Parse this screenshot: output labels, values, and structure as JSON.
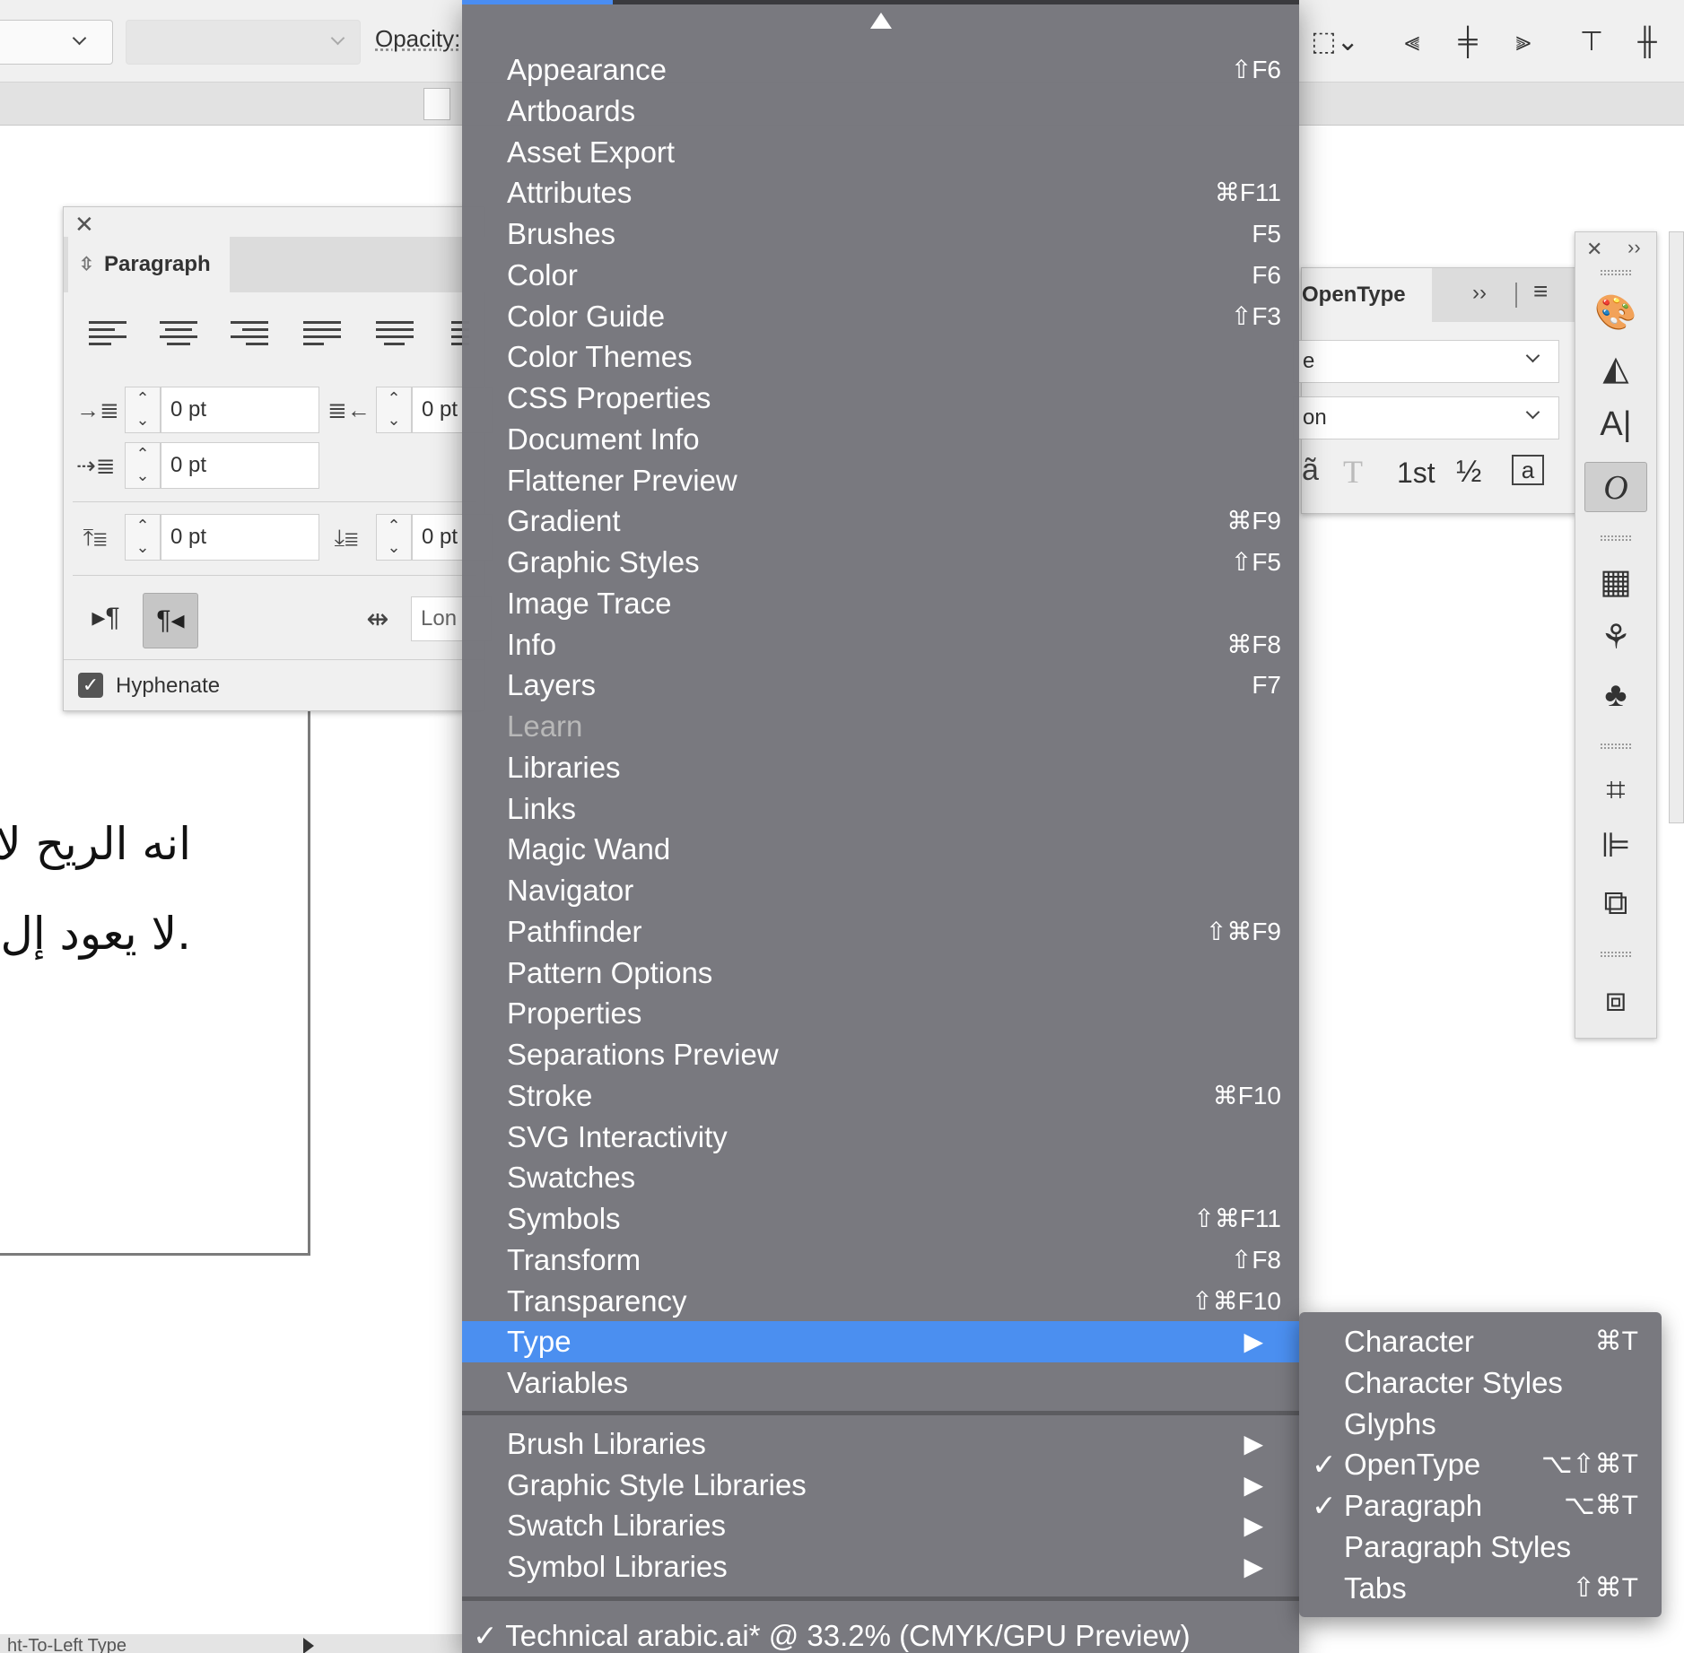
{
  "control_bar": {
    "opacity_label": "Opacity:"
  },
  "paragraph_panel": {
    "title": "Paragraph",
    "left_indent": "0 pt",
    "right_indent": "0 pt",
    "first_line_indent": "0 pt",
    "space_before": "0 pt",
    "space_after": "0 pt",
    "composer_value": "Lon",
    "hyphenate_label": "Hyphenate",
    "hyphenate_checked": true
  },
  "opentype_panel": {
    "title": "OpenType",
    "dropdown1_value": "e",
    "dropdown2_value": "on",
    "ordinal_glyph": "1st",
    "fraction_glyph": "½"
  },
  "document": {
    "line1": "انه الريح لا",
    "line2": ".لا يعود إل"
  },
  "status_bar": {
    "text": "ht-To-Left Type"
  },
  "window_menu": {
    "items": [
      {
        "label": "Appearance",
        "shortcut": "⇧F6"
      },
      {
        "label": "Artboards",
        "shortcut": ""
      },
      {
        "label": "Asset Export",
        "shortcut": ""
      },
      {
        "label": "Attributes",
        "shortcut": "⌘F11"
      },
      {
        "label": "Brushes",
        "shortcut": "F5"
      },
      {
        "label": "Color",
        "shortcut": "F6"
      },
      {
        "label": "Color Guide",
        "shortcut": "⇧F3"
      },
      {
        "label": "Color Themes",
        "shortcut": ""
      },
      {
        "label": "CSS Properties",
        "shortcut": ""
      },
      {
        "label": "Document Info",
        "shortcut": ""
      },
      {
        "label": "Flattener Preview",
        "shortcut": ""
      },
      {
        "label": "Gradient",
        "shortcut": "⌘F9"
      },
      {
        "label": "Graphic Styles",
        "shortcut": "⇧F5"
      },
      {
        "label": "Image Trace",
        "shortcut": ""
      },
      {
        "label": "Info",
        "shortcut": "⌘F8"
      },
      {
        "label": "Layers",
        "shortcut": "F7"
      },
      {
        "label": "Learn",
        "shortcut": "",
        "disabled": true
      },
      {
        "label": "Libraries",
        "shortcut": ""
      },
      {
        "label": "Links",
        "shortcut": ""
      },
      {
        "label": "Magic Wand",
        "shortcut": ""
      },
      {
        "label": "Navigator",
        "shortcut": ""
      },
      {
        "label": "Pathfinder",
        "shortcut": "⇧⌘F9"
      },
      {
        "label": "Pattern Options",
        "shortcut": ""
      },
      {
        "label": "Properties",
        "shortcut": ""
      },
      {
        "label": "Separations Preview",
        "shortcut": ""
      },
      {
        "label": "Stroke",
        "shortcut": "⌘F10"
      },
      {
        "label": "SVG Interactivity",
        "shortcut": ""
      },
      {
        "label": "Swatches",
        "shortcut": ""
      },
      {
        "label": "Symbols",
        "shortcut": "⇧⌘F11"
      },
      {
        "label": "Transform",
        "shortcut": "⇧F8"
      },
      {
        "label": "Transparency",
        "shortcut": "⇧⌘F10"
      },
      {
        "label": "Type",
        "shortcut": "",
        "submenu": true,
        "highlighted": true
      },
      {
        "label": "Variables",
        "shortcut": ""
      }
    ],
    "libraries": [
      {
        "label": "Brush Libraries"
      },
      {
        "label": "Graphic Style Libraries"
      },
      {
        "label": "Swatch Libraries"
      },
      {
        "label": "Symbol Libraries"
      }
    ],
    "open_document": "Technical arabic.ai* @ 33.2% (CMYK/GPU Preview)",
    "open_document_checked": true,
    "highlight_color": "#4b8ff0"
  },
  "type_submenu": {
    "items": [
      {
        "label": "Character",
        "shortcut": "⌘T",
        "checked": false
      },
      {
        "label": "Character Styles",
        "shortcut": "",
        "checked": false
      },
      {
        "label": "Glyphs",
        "shortcut": "",
        "checked": false
      },
      {
        "label": "OpenType",
        "shortcut": "⌥⇧⌘T",
        "checked": true
      },
      {
        "label": "Paragraph",
        "shortcut": "⌥⌘T",
        "checked": true
      },
      {
        "label": "Paragraph Styles",
        "shortcut": "",
        "checked": false
      },
      {
        "label": "Tabs",
        "shortcut": "⇧⌘T",
        "checked": false
      }
    ]
  }
}
